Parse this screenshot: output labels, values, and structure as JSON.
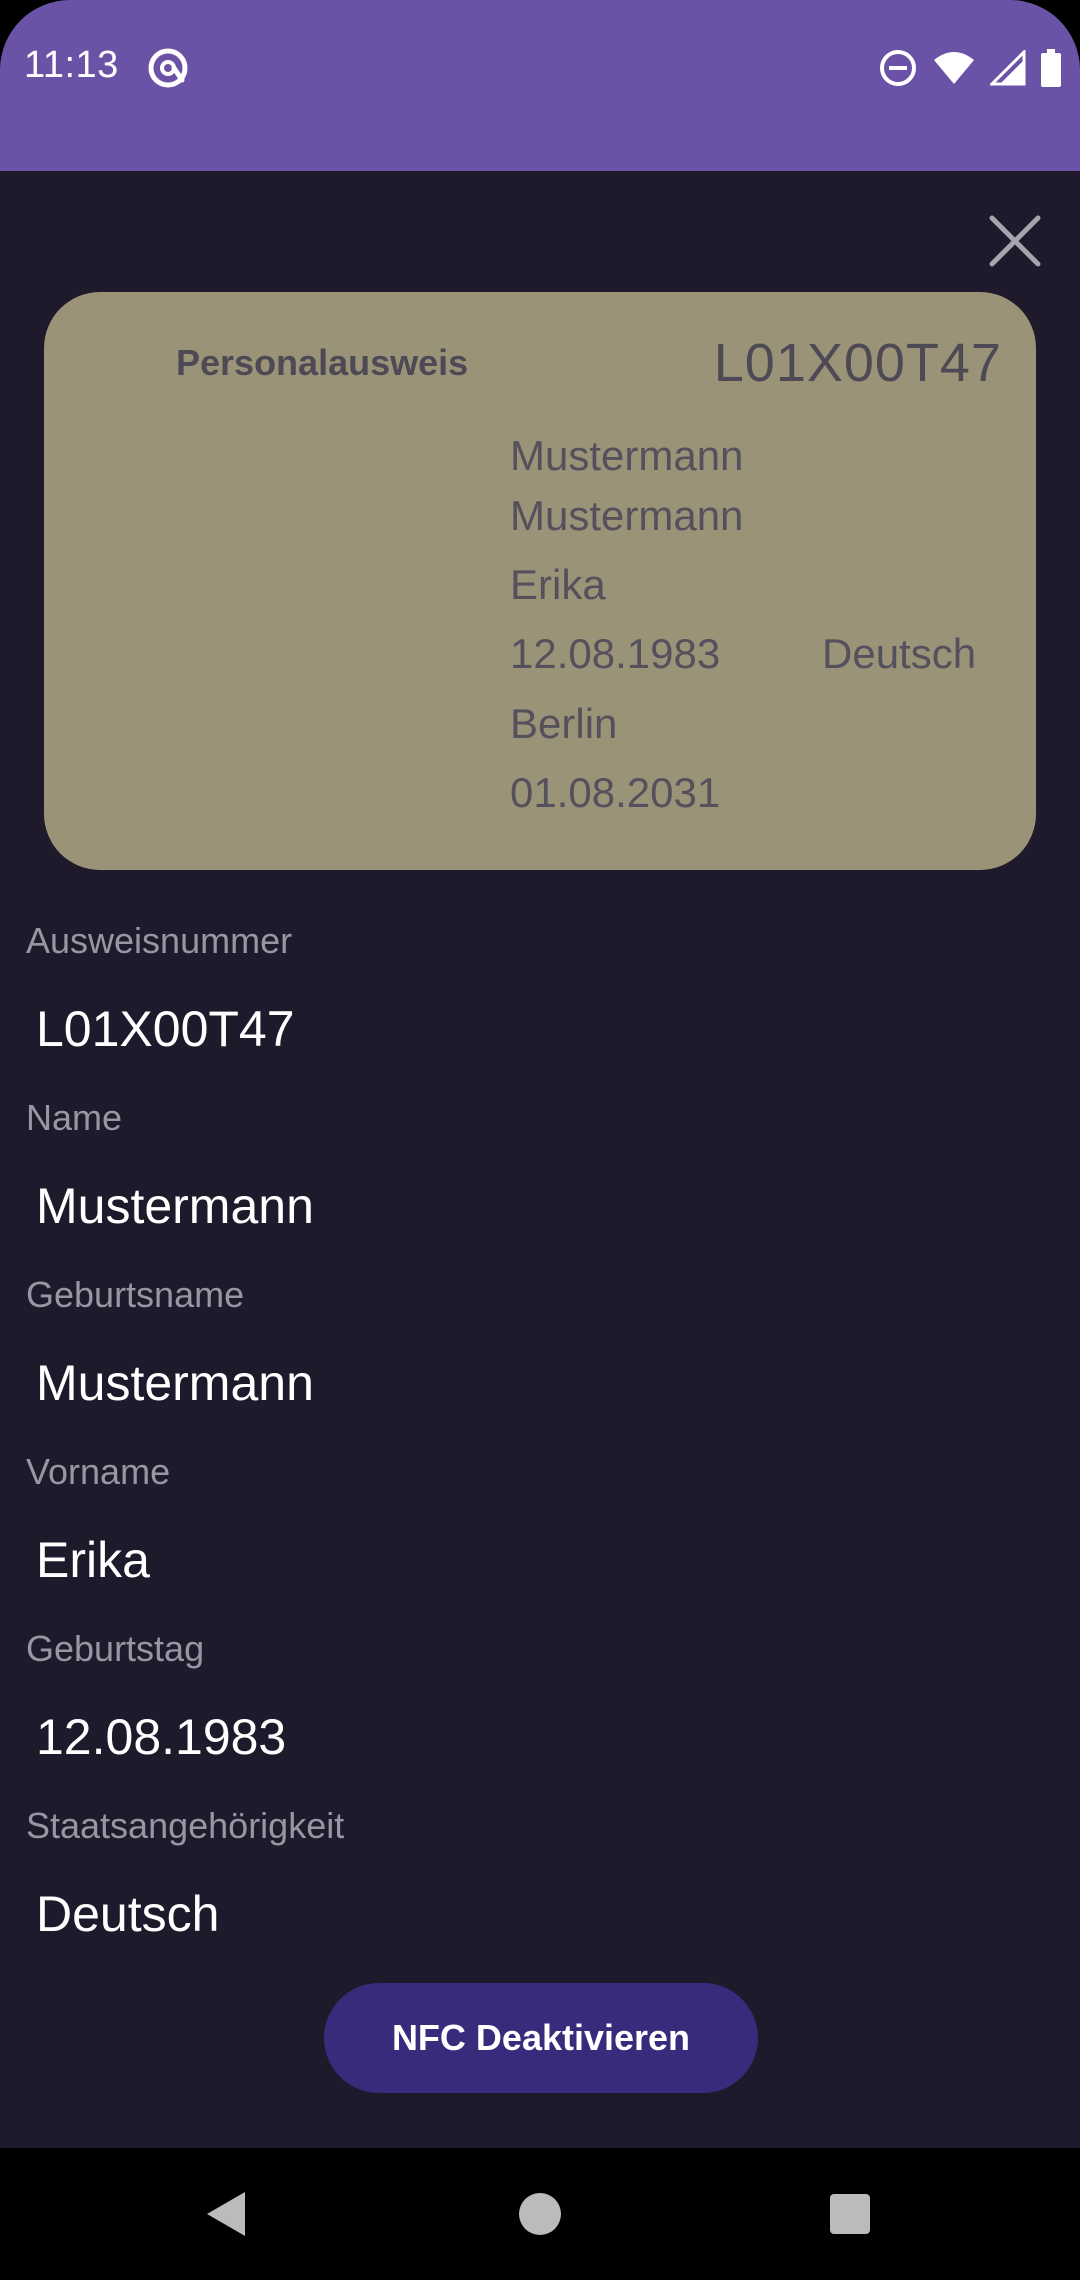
{
  "status_bar": {
    "time": "11:13",
    "left_icon": "at-sign-icon",
    "right_icons": [
      "do-not-disturb-icon",
      "wifi-icon",
      "cellular-signal-icon",
      "battery-icon"
    ]
  },
  "close_icon": "close-icon",
  "card": {
    "title": "Personalausweis",
    "number": "L01X00T47",
    "surname": "Mustermann",
    "birth_name": "Mustermann",
    "given_name": "Erika",
    "birth_date": "12.08.1983",
    "nationality": "Deutsch",
    "place_of_birth": "Berlin",
    "expiry_date": "01.08.2031"
  },
  "fields": [
    {
      "label": "Ausweisnummer",
      "value": "L01X00T47"
    },
    {
      "label": "Name",
      "value": "Mustermann"
    },
    {
      "label": "Geburtsname",
      "value": "Mustermann"
    },
    {
      "label": "Vorname",
      "value": "Erika"
    },
    {
      "label": "Geburtstag",
      "value": "12.08.1983"
    },
    {
      "label": "Staatsangehörigkeit",
      "value": "Deutsch"
    }
  ],
  "nfc_button_label": "NFC Deaktivieren",
  "navigation": [
    "back-icon",
    "home-icon",
    "recents-icon"
  ],
  "colors": {
    "status_bar": "#6a52a6",
    "background": "#1e1a2b",
    "card": "#9b9378",
    "button": "#3a2a7c"
  }
}
